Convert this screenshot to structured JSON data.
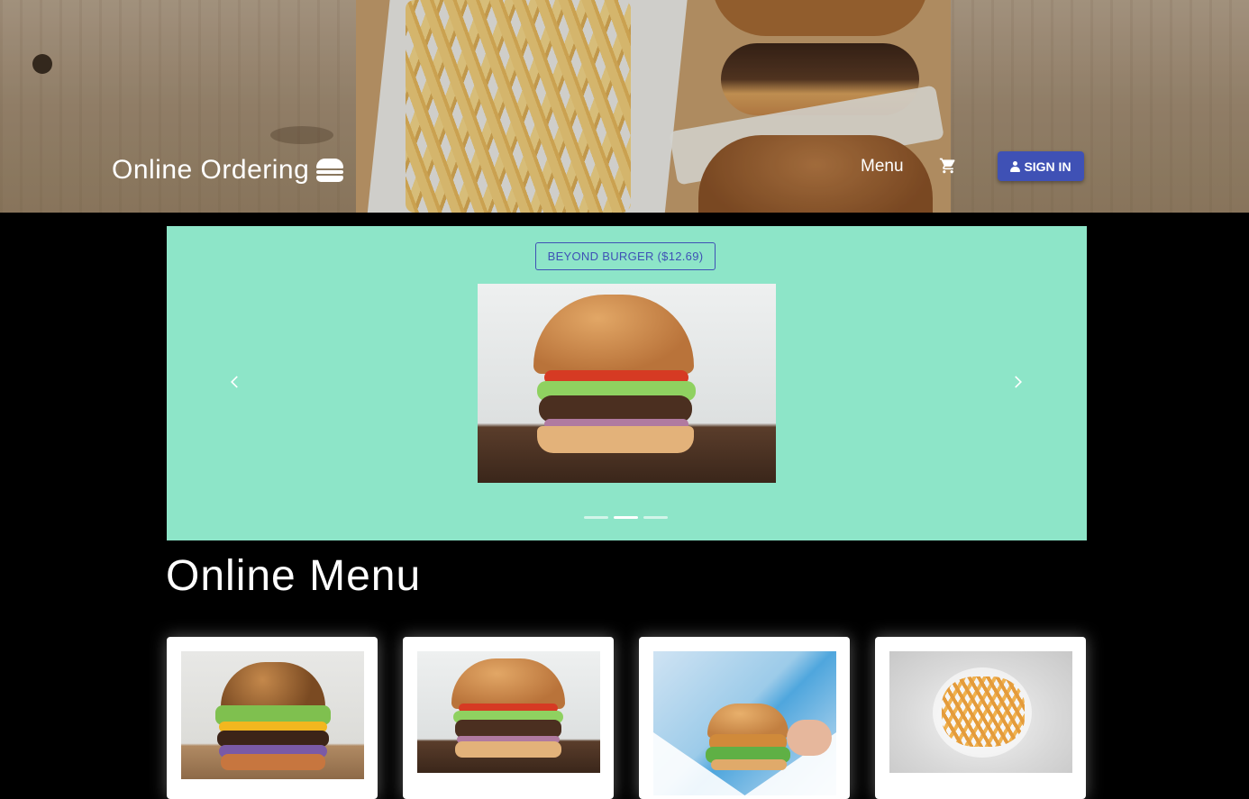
{
  "header": {
    "brand": "Online Ordering",
    "nav_menu": "Menu",
    "signin_label": "SIGN IN",
    "icons": {
      "brand": "hamburger-icon",
      "cart": "shopping-cart-icon",
      "signin": "person-icon"
    }
  },
  "carousel": {
    "current_item": "BEYOND BURGER ($12.69)",
    "slide_count": 3,
    "active_index": 1,
    "background": "#8de5c8"
  },
  "menu": {
    "title": "Online Menu"
  },
  "colors": {
    "primary": "#3f51b5",
    "page_bg": "#000000"
  }
}
